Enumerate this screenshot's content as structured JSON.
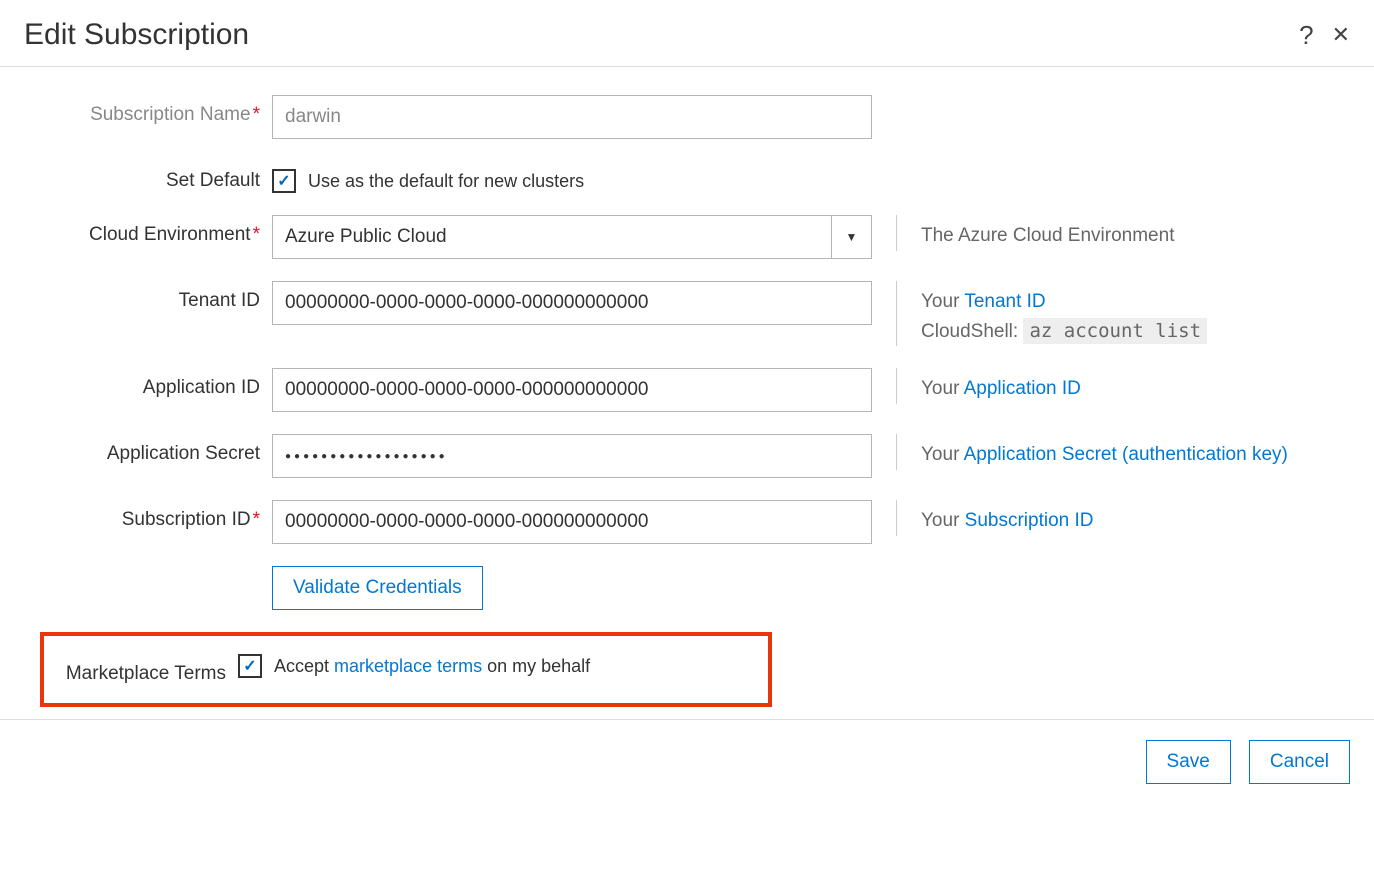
{
  "dialog": {
    "title": "Edit Subscription",
    "help_icon": "?",
    "close_icon": "✕"
  },
  "form": {
    "subscription_name": {
      "label": "Subscription Name",
      "required": "*",
      "value": "darwin"
    },
    "set_default": {
      "label": "Set Default",
      "check_mark": "✓",
      "text": "Use as the default for new clusters"
    },
    "cloud_environment": {
      "label": "Cloud Environment",
      "required": "*",
      "value": "Azure Public Cloud",
      "hint": "The Azure Cloud Environment"
    },
    "tenant_id": {
      "label": "Tenant ID",
      "value": "00000000-0000-0000-0000-000000000000",
      "hint_prefix": "Your ",
      "hint_link": "Tenant ID",
      "hint_line2_pre": "CloudShell: ",
      "hint_line2_code": "az account list"
    },
    "application_id": {
      "label": "Application ID",
      "value": "00000000-0000-0000-0000-000000000000",
      "hint_prefix": "Your ",
      "hint_link": "Application ID"
    },
    "application_secret": {
      "label": "Application Secret",
      "value": "●●●●●●●●●●●●●●●●●●",
      "hint_prefix": "Your ",
      "hint_link": "Application Secret (authentication key)"
    },
    "subscription_id": {
      "label": "Subscription ID",
      "required": "*",
      "value": "00000000-0000-0000-0000-000000000000",
      "hint_prefix": "Your ",
      "hint_link": "Subscription ID"
    },
    "validate_button": "Validate Credentials",
    "marketplace": {
      "label": "Marketplace Terms",
      "check_mark": "✓",
      "text_pre": "Accept ",
      "text_link": "marketplace terms",
      "text_post": " on my behalf"
    }
  },
  "footer": {
    "save": "Save",
    "cancel": "Cancel"
  }
}
